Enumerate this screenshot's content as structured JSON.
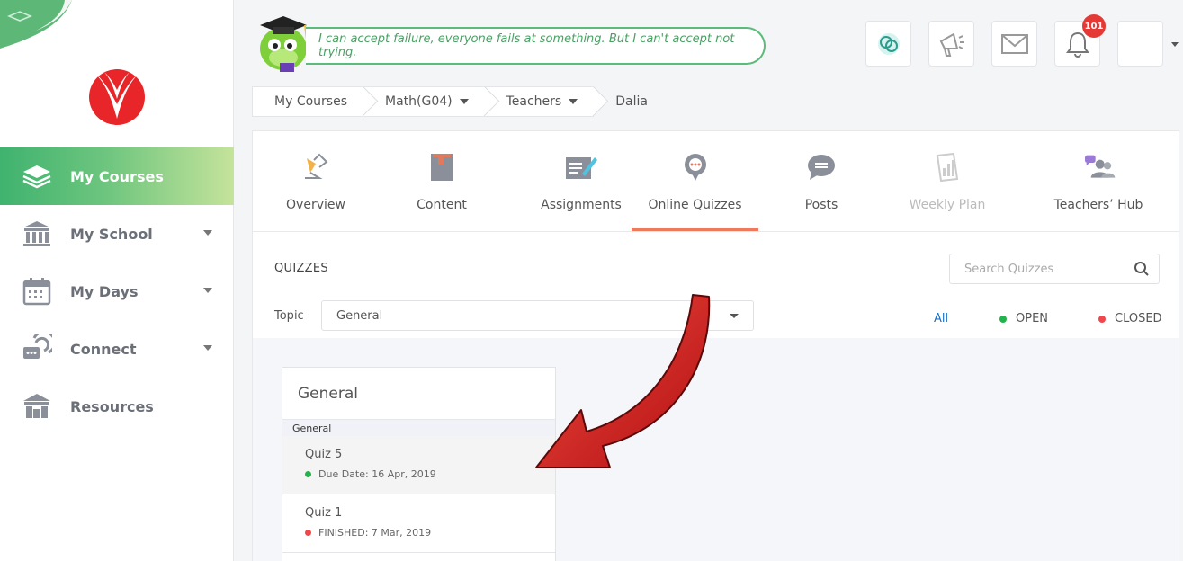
{
  "app": {
    "quote": "I can accept failure, everyone fails at something. But I can't accept not trying.",
    "notification_count": "101"
  },
  "sidebar": {
    "items": [
      {
        "label": "My Courses",
        "icon": "layers-icon",
        "active": true
      },
      {
        "label": "My School",
        "icon": "school-building-icon"
      },
      {
        "label": "My Days",
        "icon": "calendar-icon"
      },
      {
        "label": "Connect",
        "icon": "chat-bubbles-icon"
      },
      {
        "label": "Resources",
        "icon": "library-icon"
      }
    ]
  },
  "breadcrumb": {
    "items": [
      "My Courses",
      "Math(G04)",
      "Teachers",
      "Dalia"
    ]
  },
  "tabs": [
    {
      "label": "Overview",
      "icon": "lamp-icon"
    },
    {
      "label": "Content",
      "icon": "book-icon"
    },
    {
      "label": "Assignments",
      "icon": "assignment-pen-icon"
    },
    {
      "label": "Online Quizzes",
      "icon": "quiz-bubble-icon",
      "active": true
    },
    {
      "label": "Posts",
      "icon": "speech-bubble-icon"
    },
    {
      "label": "Weekly Plan",
      "icon": "chart-paper-icon",
      "disabled": true
    },
    {
      "label": "Teachers’ Hub",
      "icon": "people-chat-icon"
    }
  ],
  "quizzes": {
    "section_title": "QUIZZES",
    "search_placeholder": "Search Quizzes",
    "topic_label": "Topic",
    "topic_value": "General",
    "filters": {
      "all": "All",
      "open": "OPEN",
      "closed": "CLOSED"
    },
    "card": {
      "title": "General",
      "group": "General",
      "items": [
        {
          "name": "Quiz 5",
          "status": "Due Date: 16 Apr, 2019",
          "state": "open"
        },
        {
          "name": "Quiz 1",
          "status": "FINISHED: 7 Mar, 2019",
          "state": "closed"
        }
      ]
    }
  },
  "colors": {
    "accent_green": "#4cb874",
    "tab_underline": "#f0785b",
    "open_dot": "#22b34c",
    "closed_dot": "#f0474c",
    "link_blue": "#1a73c9",
    "badge_red": "#e53935",
    "arrow_red": "#d31b1b"
  }
}
